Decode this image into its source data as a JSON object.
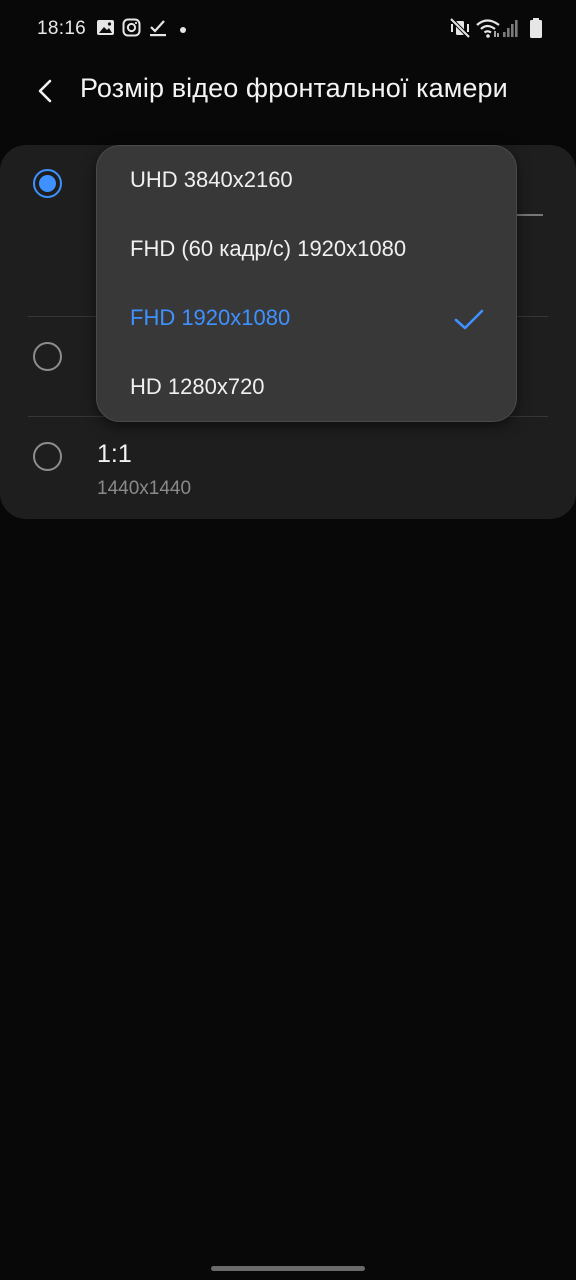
{
  "status_bar": {
    "time": "18:16",
    "left_icons": [
      "gallery-icon",
      "instagram-icon",
      "task-check-icon",
      "notification-dot-icon"
    ],
    "right_icons": [
      "mute-vibrate-icon",
      "wifi-icon",
      "cellular-signal-icon",
      "battery-icon"
    ]
  },
  "header": {
    "title": "Розмір відео фронтальної камери",
    "back_icon": "chevron-left-icon"
  },
  "options": [
    {
      "title": "",
      "subtitle": "",
      "checked": true
    },
    {
      "title": "",
      "subtitle": "",
      "checked": false
    },
    {
      "title": "1:1",
      "subtitle": "1440x1440",
      "checked": false
    }
  ],
  "dropdown": {
    "items": [
      {
        "label": "UHD 3840x2160",
        "selected": false
      },
      {
        "label": "FHD (60 кадр/с) 1920x1080",
        "selected": false
      },
      {
        "label": "FHD 1920x1080",
        "selected": true
      },
      {
        "label": "HD 1280x720",
        "selected": false
      }
    ]
  },
  "colors": {
    "accent": "#3e91ff",
    "background": "#080808",
    "card": "#1e1e1e",
    "dropdown": "#383838"
  }
}
